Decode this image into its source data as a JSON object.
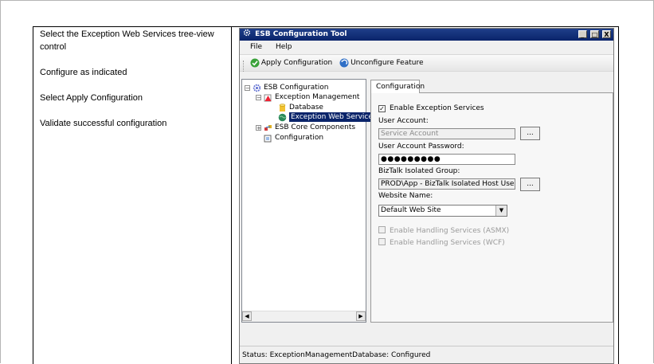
{
  "document": {
    "steps": [
      "Select the Exception Web Services tree-view control",
      "Configure as indicated",
      "Select Apply Configuration",
      "Validate successful configuration"
    ]
  },
  "window": {
    "title": "ESB Configuration Tool",
    "controls": [
      "_",
      "□",
      "X"
    ]
  },
  "menu": [
    "File",
    "Help"
  ],
  "toolbar": {
    "apply_label": "Apply Configuration",
    "unconfigure_label": "Unconfigure Feature"
  },
  "tree": {
    "root": "ESB Configuration",
    "exception_management": "Exception Management",
    "database": "Database",
    "exception_web_services": "Exception Web Services",
    "core_components": "ESB Core Components",
    "configuration": "Configuration"
  },
  "tab": {
    "label": "Configuration"
  },
  "form": {
    "enable_exception_services": "Enable Exception Services",
    "user_account_label": "User Account:",
    "user_account_value": "Service Account",
    "password_label": "User Account Password:",
    "password_value": "●●●●●●●●●",
    "isolated_group_label": "BizTalk Isolated Group:",
    "isolated_group_value": "PROD\\App - BizTalk Isolated Host Users",
    "browse_label": "...",
    "website_label": "Website Name:",
    "website_value": "Default Web Site",
    "asmx_label": "Enable Handling Services (ASMX)",
    "wcf_label": "Enable Handling Services (WCF)"
  },
  "status": {
    "text": "Status:  ExceptionManagementDatabase: Configured"
  },
  "colors": {
    "title_bar": "#0a246a",
    "selection": "#0a246a"
  }
}
